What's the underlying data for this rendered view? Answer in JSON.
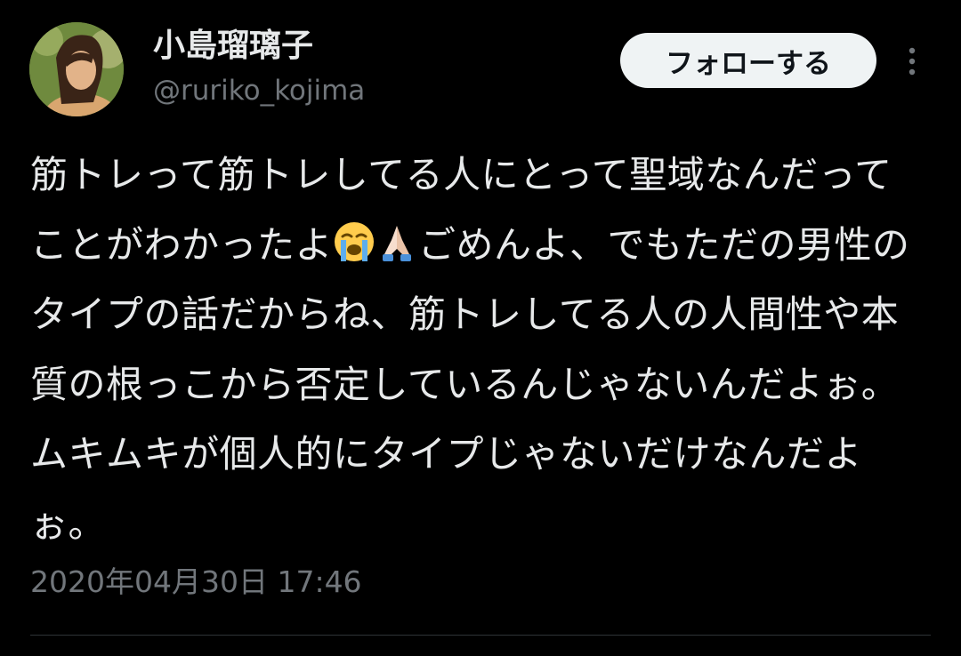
{
  "author": {
    "display_name": "小島瑠璃子",
    "handle": "@ruriko_kojima"
  },
  "follow_button": {
    "label": "フォローする"
  },
  "tweet": {
    "text_part1": "筋トレって筋トレしてる人にとって聖域なんだってことがわかったよ",
    "emoji1": "loudly-crying-face",
    "emoji2": "folded-hands",
    "text_part2": "ごめんよ、でもただの男性のタイプの話だからね、筋トレしてる人の人間性や本質の根っこから否定しているんじゃないんだよぉ。ムキムキが個人的にタイプじゃないだけなんだよぉ。",
    "timestamp": "2020年04月30日 17:46"
  },
  "icons": {
    "more": "more-vertical-icon"
  },
  "colors": {
    "background": "#000000",
    "primary_text": "#e7e9ea",
    "secondary_text": "#71767b",
    "button_bg": "#eff3f4",
    "button_text": "#0f1419",
    "divider": "#2f3336"
  }
}
